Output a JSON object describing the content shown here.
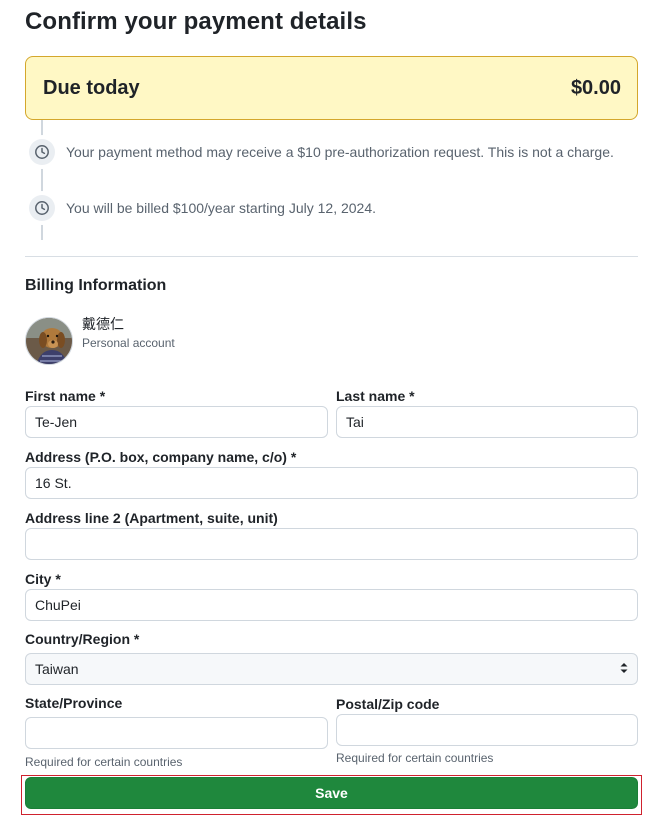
{
  "page": {
    "title": "Confirm your payment details"
  },
  "due": {
    "label": "Due today",
    "amount": "$0.00"
  },
  "timeline": [
    {
      "icon": "clock-icon",
      "text": "Your payment method may receive a $10 pre-authorization request. This is not a charge."
    },
    {
      "icon": "clock-icon",
      "text": "You will be billed $100/year starting July 12, 2024."
    }
  ],
  "billing": {
    "section_title": "Billing Information",
    "account": {
      "name": "戴德仁",
      "type": "Personal account"
    }
  },
  "form": {
    "first_name": {
      "label": "First name *",
      "value": "Te-Jen"
    },
    "last_name": {
      "label": "Last name *",
      "value": "Tai"
    },
    "address": {
      "label": "Address (P.O. box, company name, c/o) *",
      "value": "16 St."
    },
    "address2": {
      "label": "Address line 2 (Apartment, suite, unit)",
      "value": ""
    },
    "city": {
      "label": "City *",
      "value": "ChuPei"
    },
    "country": {
      "label": "Country/Region *",
      "value": "Taiwan"
    },
    "state": {
      "label": "State/Province",
      "value": "",
      "hint": "Required for certain countries"
    },
    "postal": {
      "label": "Postal/Zip code",
      "value": "",
      "hint": "Required for certain countries"
    },
    "save_label": "Save"
  },
  "colors": {
    "due_background": "#fff8c5",
    "due_border": "#d4a72c",
    "save_button": "#1f883d",
    "focus_outline": "#cf222e"
  }
}
